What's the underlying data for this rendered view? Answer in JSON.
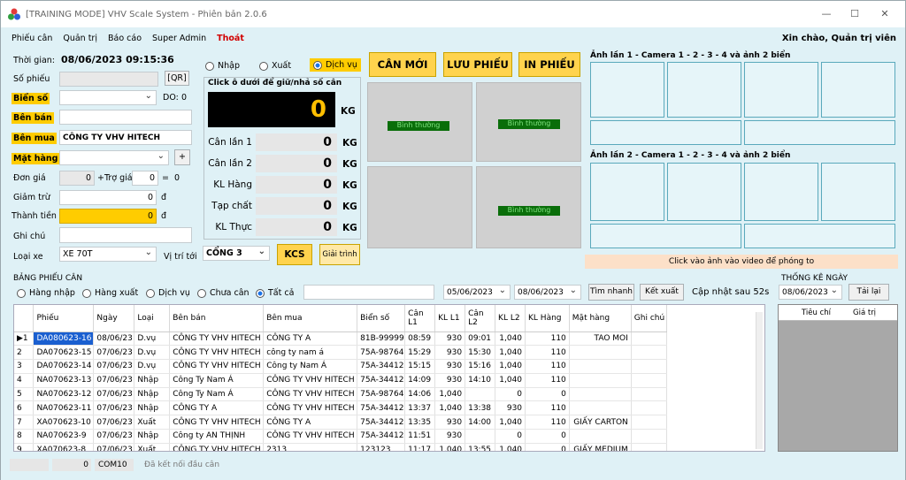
{
  "window": {
    "title": "[TRAINING MODE] VHV Scale System - Phiên bản 2.0.6"
  },
  "menu": {
    "items": [
      "Phiếu cân",
      "Quản trị",
      "Báo cáo",
      "Super Admin"
    ],
    "exit": "Thoát",
    "greeting": "Xin chào, Quản trị viên"
  },
  "form": {
    "time_label": "Thời gian:",
    "time_value": "08/06/2023 09:15:36",
    "ticket_label": "Số phiếu",
    "qr_label": "[QR]",
    "plate_label": "Biển số",
    "do_label": "DO:",
    "do_value": "0",
    "seller_label": "Bên bán",
    "buyer_label": "Bên mua",
    "buyer_value": "CÔNG TY VHV HITECH",
    "goods_label": "Mặt hàng",
    "add_label": "+",
    "price_label": "Đơn giá",
    "price_value": "0",
    "subsidy_label": "+Trợ giá",
    "subsidy_value": "0",
    "eq": "=",
    "total_inline": "0",
    "discount_label": "Giảm trừ",
    "discount_value": "0",
    "currency": "đ",
    "amount_label": "Thành tiền",
    "amount_value": "0",
    "note_label": "Ghi chú",
    "vehicle_label": "Loại xe",
    "vehicle_value": "XE 70T",
    "location_label": "Vị trí tới",
    "location_value": "CỔNG 3",
    "kcs_label": "KCS",
    "explain_label": "Giải trình"
  },
  "mode": {
    "options": [
      "Nhập",
      "Xuất",
      "Dịch vụ"
    ],
    "selected": "Dịch vụ"
  },
  "scale": {
    "hint": "Click ô dưới để giữ/nhả số cân",
    "reading": "0",
    "unit": "KG",
    "rows": [
      {
        "label": "Cân lần 1",
        "value": "0"
      },
      {
        "label": "Cân lần 2",
        "value": "0"
      },
      {
        "label": "KL Hàng",
        "value": "0"
      },
      {
        "label": "Tạp chất",
        "value": "0"
      },
      {
        "label": "KL Thực",
        "value": "0"
      }
    ]
  },
  "actions": {
    "new": "CÂN MỚI",
    "save": "LƯU PHIẾU",
    "print": "IN PHIẾU"
  },
  "sensors": {
    "status": "Bình thường"
  },
  "cameras": {
    "first_label": "Ảnh lần 1 - Camera 1 - 2 - 3 - 4 và ảnh 2 biển",
    "second_label": "Ảnh lần 2 - Camera 1 - 2 - 3 - 4 và ảnh 2 biển",
    "hint": "Click vào ảnh vào video để phóng to"
  },
  "list": {
    "title": "BẢNG PHIẾU CÂN",
    "filters": [
      "Hàng nhập",
      "Hàng xuất",
      "Dịch vụ",
      "Chưa cân",
      "Tất cả"
    ],
    "filter_selected": "Tất cả",
    "date_from": "05/06/2023",
    "date_to": "08/06/2023",
    "search_label": "Tìm nhanh",
    "export_label": "Kết xuất",
    "refresh_text": "Cập nhật sau 52s",
    "columns": [
      "Phiếu",
      "Ngày",
      "Loại",
      "Bên bán",
      "Bên mua",
      "Biển số",
      "Cân L1",
      "KL L1",
      "Cân L2",
      "KL L2",
      "KL Hàng",
      "Mặt hàng",
      "Ghi chú"
    ],
    "rows": [
      [
        "▶1",
        "DA080623-16",
        "08/06/23",
        "D.vụ",
        "CÔNG TY VHV HITECH",
        "CÔNG TY A",
        "81B-99999",
        "08:59",
        "930",
        "09:01",
        "1,040",
        "110",
        "TAO MOI",
        ""
      ],
      [
        "2",
        "DA070623-15",
        "07/06/23",
        "D.vụ",
        "CÔNG TY VHV HITECH",
        "công ty nam á",
        "75A-98764",
        "15:29",
        "930",
        "15:30",
        "1,040",
        "110",
        "",
        ""
      ],
      [
        "3",
        "DA070623-14",
        "07/06/23",
        "D.vụ",
        "CÔNG TY VHV HITECH",
        "Công ty Nam Á",
        "75A-34412",
        "15:15",
        "930",
        "15:16",
        "1,040",
        "110",
        "",
        ""
      ],
      [
        "4",
        "NA070623-13",
        "07/06/23",
        "Nhập",
        "Công Ty Nam Á",
        "CÔNG TY VHV HITECH",
        "75A-34412",
        "14:09",
        "930",
        "14:10",
        "1,040",
        "110",
        "",
        ""
      ],
      [
        "5",
        "NA070623-12",
        "07/06/23",
        "Nhập",
        "Công Ty Nam Á",
        "CÔNG TY VHV HITECH",
        "75A-98764",
        "14:06",
        "1,040",
        "",
        "0",
        "0",
        "",
        ""
      ],
      [
        "6",
        "NA070623-11",
        "07/06/23",
        "Nhập",
        "CÔNG TY A",
        "CÔNG TY VHV HITECH",
        "75A-34412",
        "13:37",
        "1,040",
        "13:38",
        "930",
        "110",
        "",
        ""
      ],
      [
        "7",
        "XA070623-10",
        "07/06/23",
        "Xuất",
        "CÔNG TY VHV HITECH",
        "CÔNG TY A",
        "75A-34412",
        "13:35",
        "930",
        "14:00",
        "1,040",
        "110",
        "GIẤY CARTON",
        ""
      ],
      [
        "8",
        "NA070623-9",
        "07/06/23",
        "Nhập",
        "Công ty AN THỊNH",
        "CÔNG TY VHV HITECH",
        "75A-34412",
        "11:51",
        "930",
        "",
        "0",
        "0",
        "",
        ""
      ],
      [
        "9",
        "XA070623-8",
        "07/06/23",
        "Xuất",
        "CÔNG TY VHV HITECH",
        "2313",
        "123123",
        "11:17",
        "1,040",
        "13:55",
        "1,040",
        "0",
        "GIẤY MEDIUM",
        ""
      ]
    ]
  },
  "stats": {
    "title": "THỐNG KÊ NGÀY",
    "date": "08/06/2023",
    "reload": "Tải lại",
    "col1": "Tiêu chí",
    "col2": "Giá trị"
  },
  "statusbar": {
    "value": "0",
    "port": "COM10",
    "message": "Đã kết nối đầu cân"
  },
  "colors": {
    "accent": "#ffcc00",
    "panel": "#dff1f6",
    "selected": "#1a5fd0",
    "ok": "#0a6e0a"
  }
}
